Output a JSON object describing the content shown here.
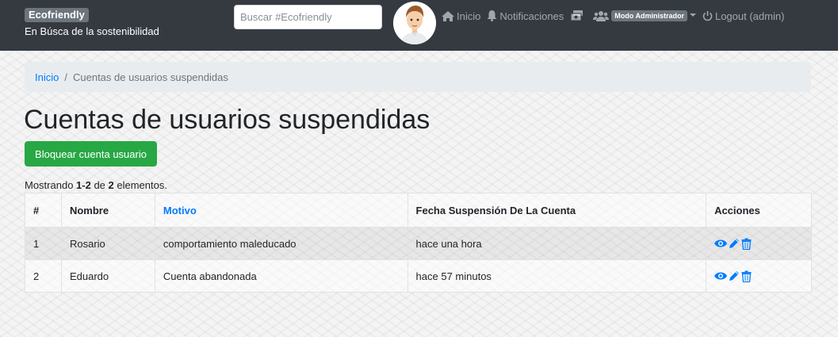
{
  "navbar": {
    "brand": "Ecofriendly",
    "tagline": "En Búsca de la sostenibilidad",
    "search_placeholder": "Buscar #Ecofriendly",
    "links": {
      "home": "Inicio",
      "notifications": "Notificaciones",
      "admin_mode": "Modo Administrador",
      "logout": "Logout (admin)"
    }
  },
  "breadcrumb": {
    "home": "Inicio",
    "separator": "/",
    "current": "Cuentas de usuarios suspendidas"
  },
  "page": {
    "title": "Cuentas de usuarios suspendidas",
    "action_button": "Bloquear cuenta usuario",
    "summary": {
      "prefix": "Mostrando ",
      "range": "1-2",
      "middle": " de ",
      "total": "2",
      "suffix": " elementos."
    }
  },
  "table": {
    "headers": [
      "#",
      "Nombre",
      "Motivo",
      "Fecha Suspensión De La Cuenta",
      "Acciones"
    ],
    "rows": [
      [
        "1",
        "Rosario",
        "comportamiento maleducado",
        "hace una hora"
      ],
      [
        "2",
        "Eduardo",
        "Cuenta abandonada",
        "hace 57 minutos"
      ]
    ],
    "action_icons": [
      "eye-icon",
      "pencil-icon",
      "trash-icon"
    ]
  },
  "colors": {
    "navbar": "#343a40",
    "link": "#007bff",
    "success": "#28a745"
  }
}
